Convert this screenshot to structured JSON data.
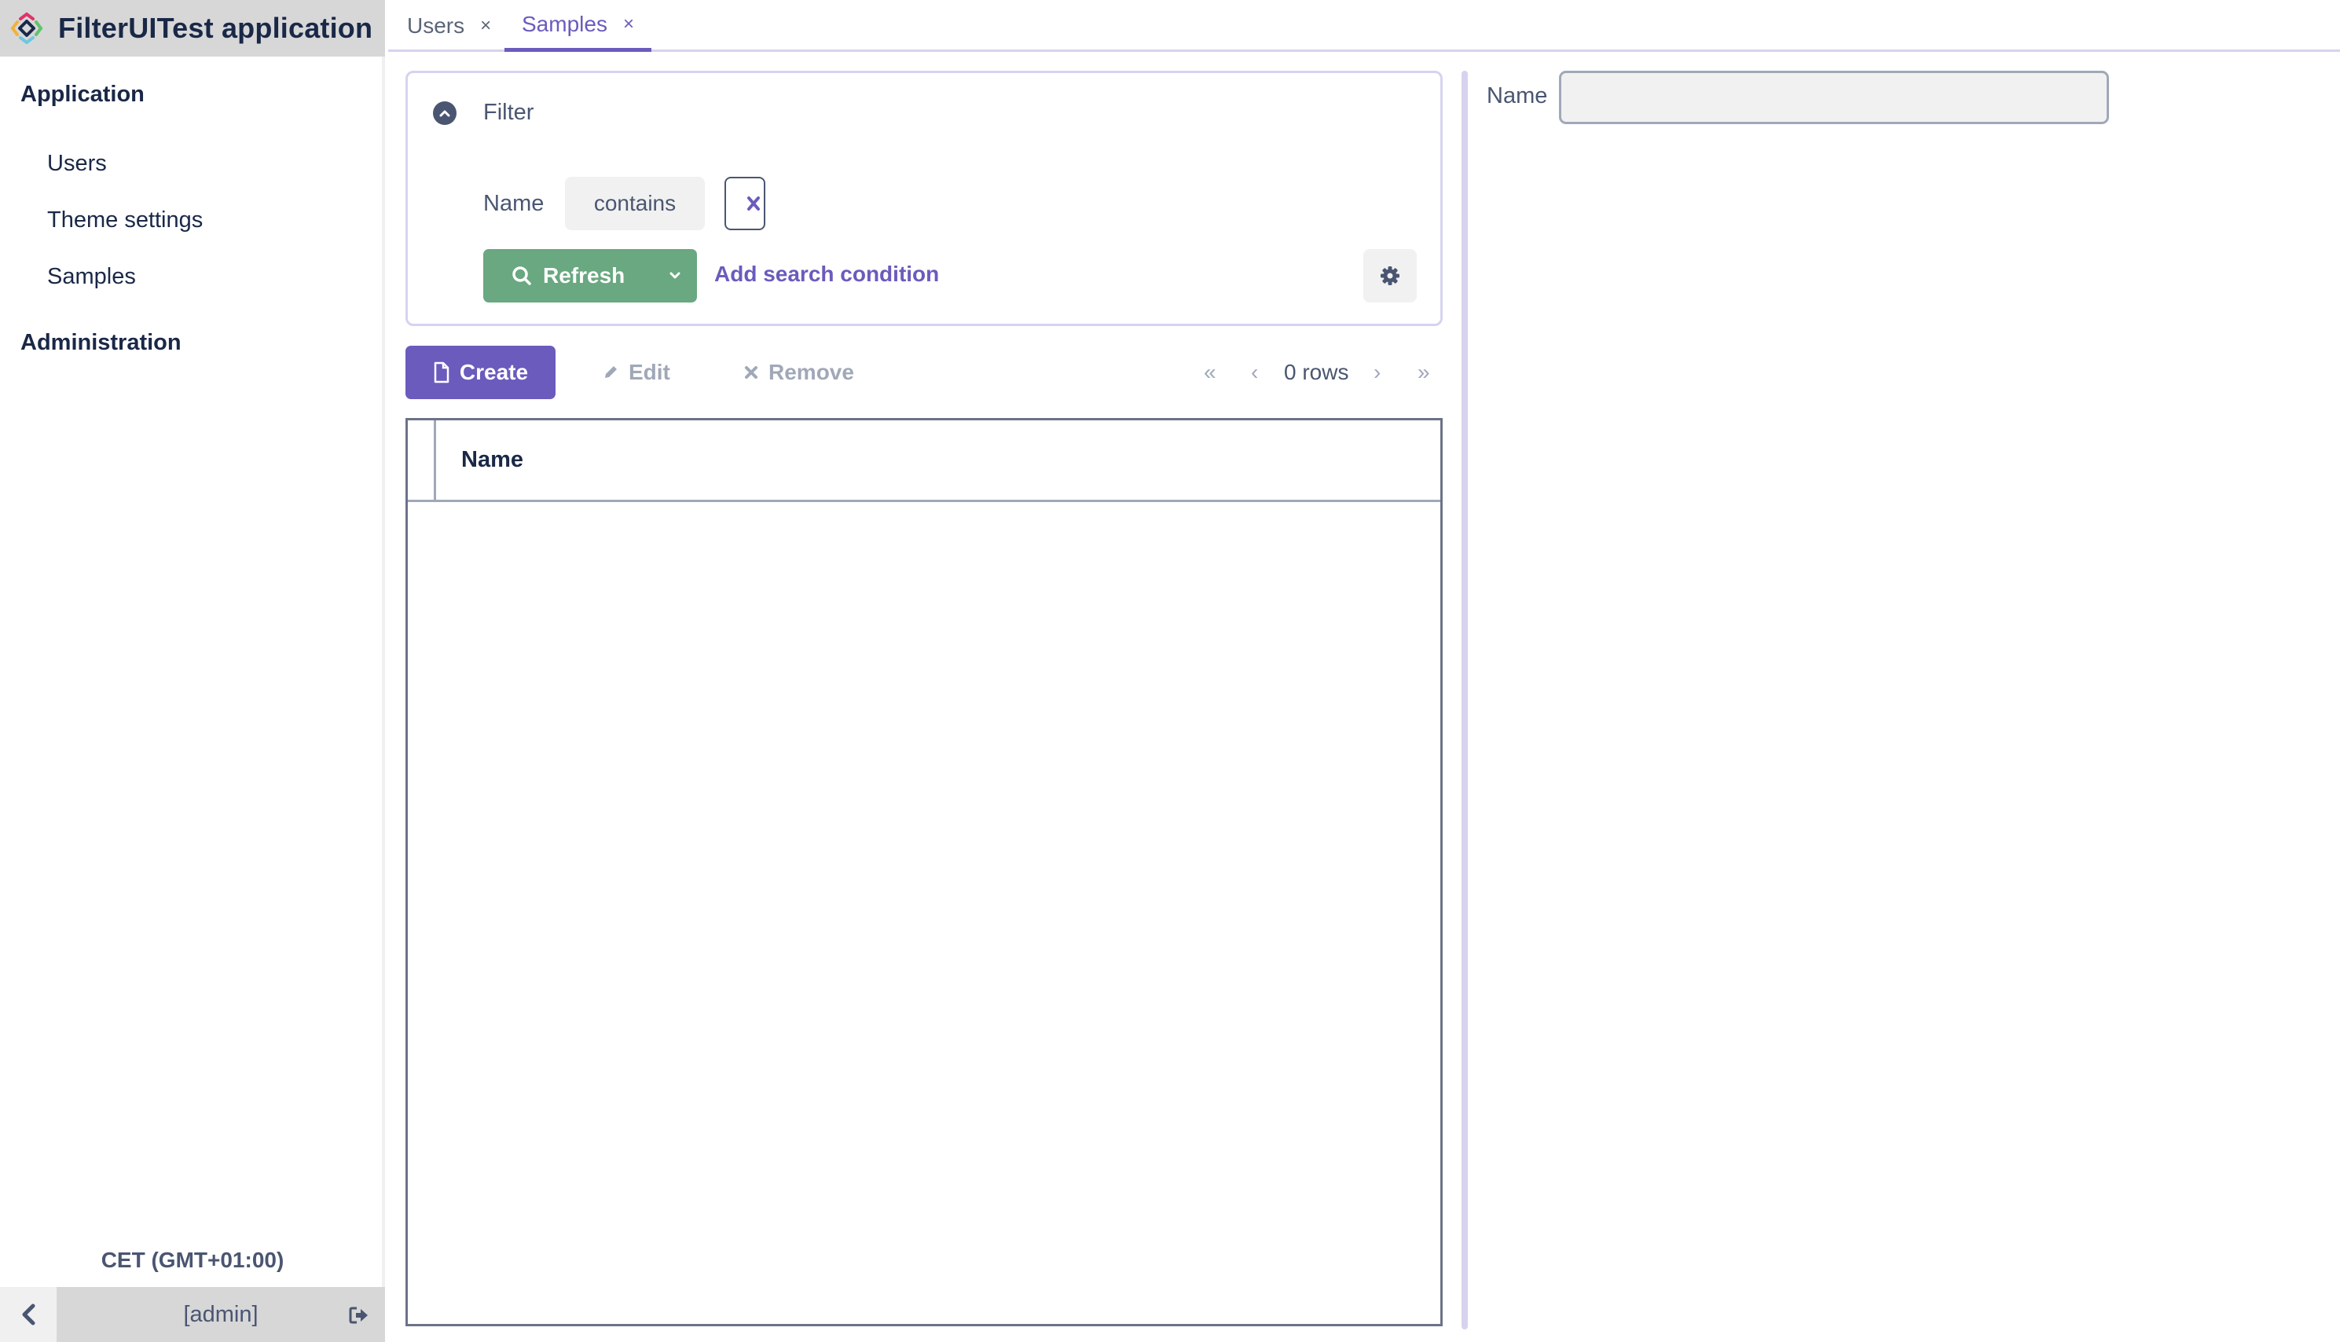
{
  "app": {
    "title": "FilterUITest application",
    "timezone": "CET (GMT+01:00)",
    "user": "[admin]"
  },
  "sidebar": {
    "groups": [
      {
        "label": "Application",
        "items": [
          {
            "label": "Users"
          },
          {
            "label": "Theme settings"
          },
          {
            "label": "Samples"
          }
        ]
      },
      {
        "label": "Administration",
        "items": []
      }
    ]
  },
  "tabs": [
    {
      "label": "Users",
      "close": "×",
      "active": false
    },
    {
      "label": "Samples",
      "close": "×",
      "active": true
    }
  ],
  "filter": {
    "title": "Filter",
    "condition": {
      "property": "Name",
      "operator": "contains",
      "value": ""
    },
    "refresh_label": "Refresh",
    "add_condition_label": "Add search condition"
  },
  "toolbar": {
    "create_label": "Create",
    "edit_label": "Edit",
    "remove_label": "Remove"
  },
  "pagination": {
    "rows_label": "0 rows",
    "first": "«",
    "prev": "‹",
    "next": "›",
    "last": "»"
  },
  "table": {
    "columns": [
      "Name"
    ],
    "rows": []
  },
  "detail": {
    "name_label": "Name",
    "name_value": ""
  },
  "colors": {
    "accent": "#6a5bbd",
    "success": "#69a880",
    "text": "#1a2847",
    "muted": "#4a5671",
    "disabled": "#a0a8b8"
  }
}
